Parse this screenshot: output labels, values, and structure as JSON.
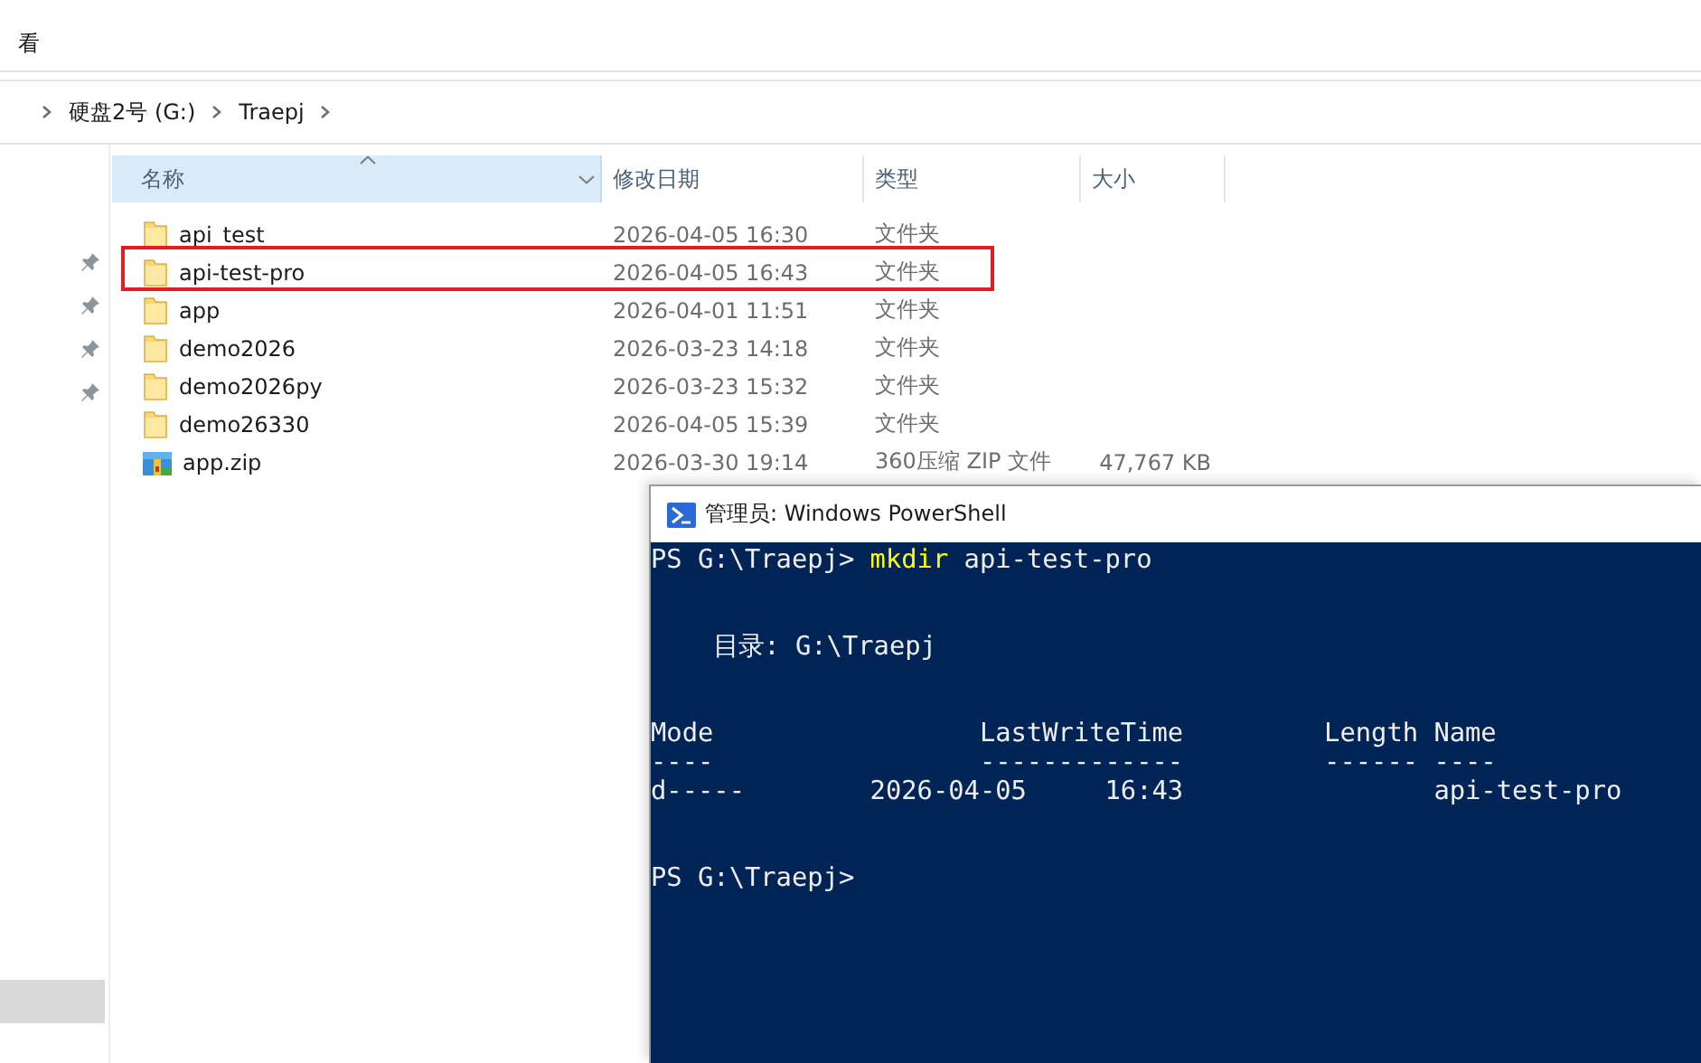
{
  "ribbon": {
    "tab": "看"
  },
  "address_bar": {
    "crumbs": [
      {
        "label": "硬盘2号 (G:)"
      },
      {
        "label": "Traepj"
      }
    ]
  },
  "sidebar": {
    "pinned_items": [
      {
        "pinned": true
      },
      {
        "pinned": true
      },
      {
        "pinned": true
      },
      {
        "pinned": true
      }
    ],
    "lower_items": [
      {
        "selected": true
      }
    ]
  },
  "file_list": {
    "columns": [
      {
        "label": "名称",
        "sorted": true
      },
      {
        "label": "修改日期",
        "sorted": false
      },
      {
        "label": "类型",
        "sorted": false
      },
      {
        "label": "大小",
        "sorted": false
      }
    ],
    "rows": [
      {
        "kind": "folder",
        "name": "api_test",
        "date": "2026-04-05 16:30",
        "type": "文件夹",
        "highlighted": false
      },
      {
        "kind": "folder",
        "name": "api-test-pro",
        "date": "2026-04-05 16:43",
        "type": "文件夹",
        "highlighted": true
      },
      {
        "kind": "folder",
        "name": "app",
        "date": "2026-04-01 11:51",
        "type": "文件夹",
        "highlighted": false
      },
      {
        "kind": "folder",
        "name": "demo2026",
        "date": "2026-03-23 14:18",
        "type": "文件夹",
        "highlighted": false
      },
      {
        "kind": "folder",
        "name": "demo2026py",
        "date": "2026-03-23 15:32",
        "type": "文件夹",
        "highlighted": false
      },
      {
        "kind": "folder",
        "name": "demo26330",
        "date": "2026-04-05 15:39",
        "type": "文件夹",
        "highlighted": false
      },
      {
        "kind": "zip",
        "name": "app.zip",
        "date": "2026-03-30 19:14",
        "type": "360压缩 ZIP 文件",
        "size": "47,767 KB",
        "highlighted": false
      }
    ]
  },
  "powershell": {
    "title": "管理员: Windows PowerShell",
    "lines": [
      {
        "kind": "prompt",
        "prompt": "PS G:\\Traepj> ",
        "command": "mkdir",
        "args": " api-test-pro"
      },
      {
        "kind": "blank"
      },
      {
        "kind": "blank"
      },
      {
        "kind": "output",
        "text": "    目录: G:\\Traepj"
      },
      {
        "kind": "blank"
      },
      {
        "kind": "blank"
      },
      {
        "kind": "output",
        "text": "Mode                 LastWriteTime         Length Name"
      },
      {
        "kind": "output",
        "text": "----                 -------------         ------ ----"
      },
      {
        "kind": "output",
        "text": "d-----        2026-04-05     16:43                api-test-pro"
      },
      {
        "kind": "blank"
      },
      {
        "kind": "blank"
      },
      {
        "kind": "prompt",
        "prompt": "PS G:\\Traepj>"
      }
    ]
  }
}
